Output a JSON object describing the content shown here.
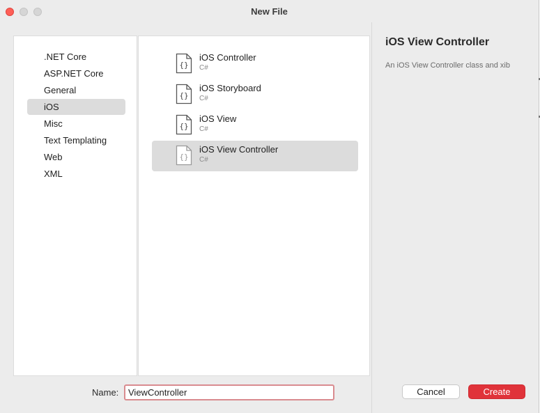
{
  "window": {
    "title": "New File"
  },
  "categories": [
    {
      "label": ".NET Core",
      "selected": false
    },
    {
      "label": "ASP.NET Core",
      "selected": false
    },
    {
      "label": "General",
      "selected": false
    },
    {
      "label": "iOS",
      "selected": true
    },
    {
      "label": "Misc",
      "selected": false
    },
    {
      "label": "Text Templating",
      "selected": false
    },
    {
      "label": "Web",
      "selected": false
    },
    {
      "label": "XML",
      "selected": false
    }
  ],
  "templates": [
    {
      "name": "iOS Controller",
      "language": "C#",
      "icon": "code-file-icon",
      "selected": false
    },
    {
      "name": "iOS Storyboard",
      "language": "C#",
      "icon": "code-file-icon",
      "selected": false
    },
    {
      "name": "iOS View",
      "language": "C#",
      "icon": "code-file-icon",
      "selected": false
    },
    {
      "name": "iOS View Controller",
      "language": "C#",
      "icon": "code-file-icon",
      "selected": true
    }
  ],
  "details": {
    "title": "iOS View Controller",
    "description": "An iOS View Controller class and xib"
  },
  "name_field": {
    "label": "Name:",
    "value": "ViewController"
  },
  "buttons": {
    "cancel": "Cancel",
    "create": "Create"
  },
  "colors": {
    "accent": "#e0333a",
    "focus_ring": "#d98b8f",
    "selection": "#dcdcdc"
  }
}
